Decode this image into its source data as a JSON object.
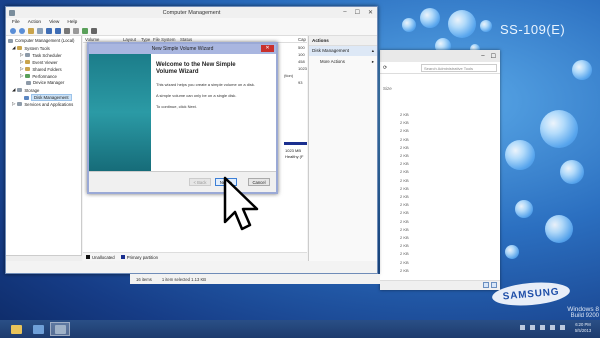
{
  "desktop": {
    "brand_text": "SS-109(E)",
    "logo_text": "SAMSUNG",
    "watermark": {
      "line1": "Windows 8",
      "line2": "Build 9200"
    }
  },
  "explorer": {
    "search_placeholder": "Search Administrative Tools",
    "column_size": "Size",
    "sizes": [
      "2 KB",
      "2 KB",
      "2 KB",
      "2 KB",
      "2 KB",
      "2 KB",
      "2 KB",
      "2 KB",
      "2 KB",
      "2 KB",
      "2 KB",
      "2 KB",
      "2 KB",
      "2 KB",
      "2 KB",
      "2 KB",
      "2 KB",
      "2 KB",
      "2 KB",
      "2 KB"
    ]
  },
  "cm": {
    "title": "Computer Management",
    "window_buttons": {
      "minimize": "–",
      "maximize": "☐",
      "close": "✕"
    },
    "menu": [
      "File",
      "Action",
      "View",
      "Help"
    ],
    "tree": {
      "root": "Computer Management (Local)",
      "system_tools": "System Tools",
      "task_scheduler": "Task Scheduler",
      "event_viewer": "Event Viewer",
      "shared_folders": "Shared Folders",
      "performance": "Performance",
      "device_manager": "Device Manager",
      "storage": "Storage",
      "disk_management": "Disk Management",
      "services": "Services and Applications"
    },
    "columns": [
      "Volume",
      "Layout",
      "Type",
      "File System",
      "Status",
      "Cap"
    ],
    "capacities": [
      "500",
      "100",
      "458",
      "1023",
      "(tion)",
      "93"
    ],
    "disk_info": [
      "1023 MB",
      "Healthy (F"
    ],
    "legend": {
      "unallocated": "Unallocated",
      "primary": "Primary partition"
    },
    "actions": {
      "title": "Actions",
      "section": "Disk Management",
      "more": "More Actions"
    },
    "status": {
      "items": "16 items",
      "selected": "1 item selected  1.13 KB"
    }
  },
  "wizard": {
    "title": "New Simple Volume Wizard",
    "close": "✕",
    "heading_line1": "Welcome to the New Simple",
    "heading_line2": "Volume Wizard",
    "text1": "This wizard helps you create a simple volume on a disk.",
    "text2": "A simple volume can only be on a single disk.",
    "text3": "To continue, click Next.",
    "buttons": {
      "back": "< Back",
      "next": "Next >",
      "cancel": "Cancel"
    }
  },
  "clock": {
    "time": "6:20 PM",
    "date": "5/5/2013"
  },
  "colors": {
    "accent": "#3c7fd6",
    "unallocated": "#111111",
    "primary_partition": "#1a2f8f",
    "wizard_side": "#2b9aa5"
  }
}
